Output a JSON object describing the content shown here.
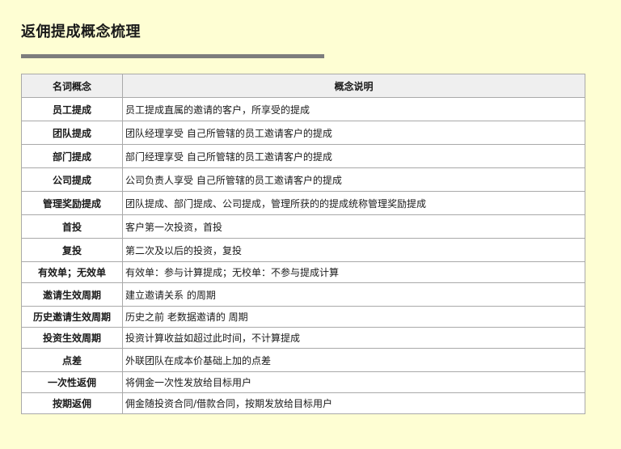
{
  "page": {
    "title": "返佣提成概念梳理"
  },
  "table": {
    "headers": [
      "名词概念",
      "概念说明"
    ],
    "rows": [
      {
        "term": "员工提成",
        "desc": "员工提成直属的邀请的客户，所享受的提成"
      },
      {
        "term": "团队提成",
        "desc": "团队经理享受 自己所管辖的员工邀请客户的提成"
      },
      {
        "term": "部门提成",
        "desc": "部门经理享受 自己所管辖的员工邀请客户的提成"
      },
      {
        "term": "公司提成",
        "desc": "公司负责人享受 自己所管辖的员工邀请客户的提成"
      },
      {
        "term": "管理奖励提成",
        "desc": "团队提成、部门提成、公司提成，管理所获的的提成统称管理奖励提成"
      },
      {
        "term": "首投",
        "desc": "客户第一次投资，首投"
      },
      {
        "term": "复投",
        "desc": "第二次及以后的投资，复投"
      },
      {
        "term": "有效单；无效单",
        "desc": "有效单：参与计算提成；无校单：不参与提成计算"
      },
      {
        "term": "邀请生效周期",
        "desc": "建立邀请关系 的周期"
      },
      {
        "term": "历史邀请生效周期",
        "desc": "历史之前 老数据邀请的 周期"
      },
      {
        "term": "投资生效周期",
        "desc": "投资计算收益如超过此时间，不计算提成"
      },
      {
        "term": "点差",
        "desc": "外联团队在成本价基础上加的点差"
      },
      {
        "term": "一次性返佣",
        "desc": "将佣金一次性发放给目标用户"
      },
      {
        "term": "按期返佣",
        "desc": "佣金随投资合同/借款合同，按期发放给目标用户"
      }
    ]
  }
}
